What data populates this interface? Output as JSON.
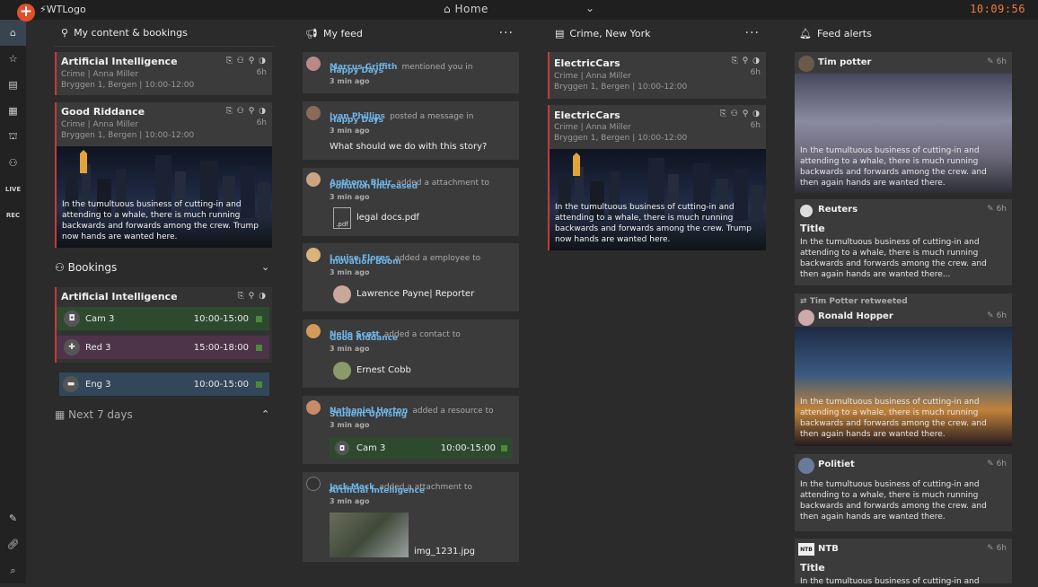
{
  "topbar": {
    "logo": "WTLogo",
    "home": "Home",
    "clock": "10:09:56"
  },
  "sidebar": {
    "items": [
      "home",
      "star",
      "document",
      "calendar",
      "org",
      "people",
      "LIVE",
      "REC"
    ],
    "bottom": [
      "pin",
      "link",
      "search"
    ]
  },
  "col1": {
    "title": "My content & bookings",
    "cards": [
      {
        "title": "Artificial Intelligence",
        "meta1": "Crime | Anna Miller",
        "meta2": "Bryggen 1, Bergen | 10:00-12:00",
        "age": "6h"
      },
      {
        "title": "Good Riddance",
        "meta1": "Crime | Anna Miller",
        "meta2": "Bryggen 1, Bergen | 10:00-12:00",
        "age": "6h",
        "text": "In the tumultuous business of cutting-in and attending to a whale, there is much running backwards and forwards among the crew. Trump now hands are wanted here."
      }
    ],
    "bookings_label": "Bookings",
    "booking_group": {
      "title": "Artificial Intelligence",
      "items": [
        {
          "name": "Cam 3",
          "time": "10:00-15:00",
          "color": "#2e4a2e"
        },
        {
          "name": "Red 3",
          "time": "15:00-18:00",
          "color": "#4e3349"
        }
      ]
    },
    "eng": {
      "name": "Eng 3",
      "time": "10:00-15:00",
      "color": "#33475a"
    },
    "next7": "Next 7 days"
  },
  "col2": {
    "title": "My feed",
    "items": [
      {
        "name": "Marcus Griffith",
        "action": "mentioned you in",
        "link": "Happy Days",
        "time": "3 min ago"
      },
      {
        "name": "Ivan Phillips",
        "action": "posted a message in",
        "link": "Happy Days",
        "time": "3 min ago",
        "message": "What should we do with this story?"
      },
      {
        "name": "Anthony Blair",
        "action": "added a attachment to",
        "link": "Pollution Increased",
        "time": "3 min ago",
        "file_icon": ".pdf",
        "file": "legal docs.pdf"
      },
      {
        "name": "Louise Flores",
        "action": "added a employee to",
        "link": "Inovation Boom",
        "time": "3 min ago",
        "person": "Lawrence Payne",
        "role": "| Reporter"
      },
      {
        "name": "Nelle Scott",
        "action": "added a contact to",
        "link": "Good Riddance",
        "time": "3 min ago",
        "person": "Ernest Cobb"
      },
      {
        "name": "Nathaniel Horton",
        "action": "added a resource to",
        "link": "Student Uprising",
        "time": "3 min ago",
        "resource": "Cam 3",
        "rtime": "10:00-15:00"
      },
      {
        "name": "Jack Mack",
        "action": "added a attachment to",
        "link": "Artificial Intelligence",
        "time": "3 min ago",
        "file": "img_1231.jpg"
      }
    ]
  },
  "col3": {
    "title": "Crime, New York",
    "cards": [
      {
        "title": "ElectricCars",
        "meta1": "Crime | Anna Miller",
        "meta2": "Bryggen 1, Bergen | 10:00-12:00",
        "age": "6h"
      },
      {
        "title": "ElectricCars",
        "meta1": "Crime | Anna Miller",
        "meta2": "Bryggen 1, Bergen | 10:00-12:00",
        "age": "6h",
        "text": "In the tumultuous business of cutting-in and attending to a whale, there is much running backwards and forwards among the crew. Trump now hands are wanted here."
      }
    ]
  },
  "col4": {
    "title": "Feed alerts",
    "alerts": [
      {
        "name": "Tim potter",
        "age": "6h",
        "text": "In the tumultuous business of cutting-in and attending to a whale, there is much running backwards and forwards among the crew. and then again hands are wanted there."
      },
      {
        "name": "Reuters",
        "age": "6h",
        "title": "Title",
        "text": "In the tumultuous business of cutting-in and attending to a whale, there is much running backwards and forwards among the crew. and then again hands are wanted there..."
      },
      {
        "retweet": "Tim Potter retweeted",
        "name": "Ronald Hopper",
        "age": "6h",
        "text": "In the tumultuous business of cutting-in and attending to a whale, there is much running backwards and forwards among the crew. and then again hands are wanted there."
      },
      {
        "name": "Politiet",
        "age": "6h",
        "text": "In the tumultuous business of cutting-in and attending to a whale, there is much running backwards and forwards among the crew. and then again hands are wanted there."
      },
      {
        "name": "NTB",
        "badge": "NTB",
        "age": "6h",
        "title": "Title",
        "text": "In the tumultuous business of cutting-in and"
      }
    ]
  }
}
